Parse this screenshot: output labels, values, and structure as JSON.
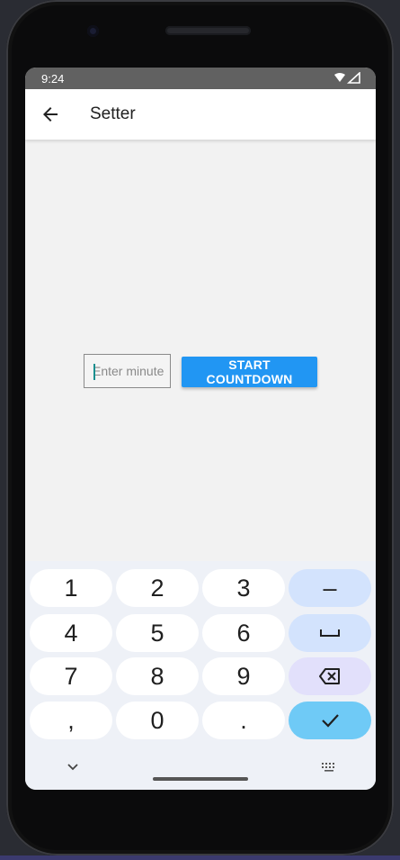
{
  "status_bar": {
    "time": "9:24",
    "icons": [
      "wifi-icon",
      "signal-icon"
    ]
  },
  "app_bar": {
    "title": "Setter",
    "back_icon": "arrow-back-icon"
  },
  "form": {
    "minutes_placeholder": "Enter minute",
    "minutes_value": "",
    "start_button_label": "START COUNTDOWN"
  },
  "keyboard": {
    "rows": [
      [
        "1",
        "2",
        "3",
        "–"
      ],
      [
        "4",
        "5",
        "6",
        "space"
      ],
      [
        "7",
        "8",
        "9",
        "backspace"
      ],
      [
        ",",
        "0",
        ".",
        "done"
      ]
    ],
    "hide_icon": "chevron-down-icon",
    "switch_icon": "keyboard-icon"
  },
  "colors": {
    "accent": "#2196f3",
    "status_bar": "#616161",
    "done_key": "#6fcaf6",
    "function_key": "#d3e3fd"
  }
}
